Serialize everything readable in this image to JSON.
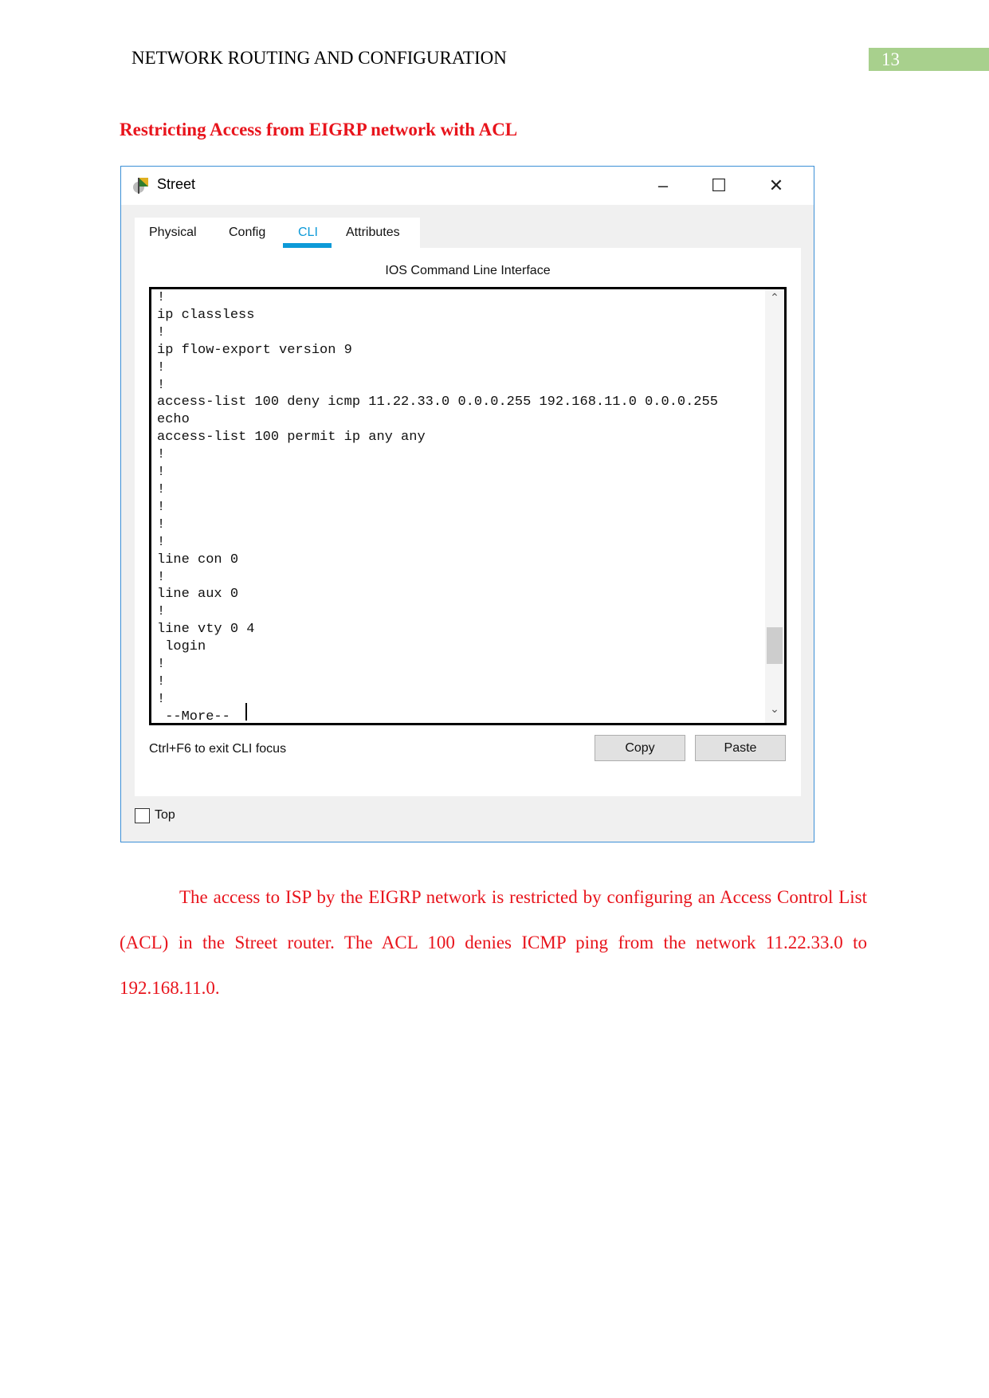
{
  "header": {
    "title": "NETWORK ROUTING AND CONFIGURATION",
    "page_number": "13"
  },
  "heading": "Restricting Access from EIGRP network with ACL",
  "window": {
    "title": "Street",
    "controls": {
      "minimize": "–",
      "maximize": "☐",
      "close": "✕"
    },
    "tabs": [
      {
        "label": "Physical"
      },
      {
        "label": "Config"
      },
      {
        "label": "CLI",
        "active": true
      },
      {
        "label": "Attributes"
      }
    ],
    "cli_title": "IOS Command Line Interface",
    "terminal_lines": [
      "!",
      "ip classless",
      "!",
      "ip flow-export version 9",
      "!",
      "!",
      "access-list 100 deny icmp 11.22.33.0 0.0.0.255 192.168.11.0 0.0.0.255",
      "echo",
      "access-list 100 permit ip any any",
      "!",
      "!",
      "!",
      "!",
      "!",
      "!",
      "line con 0",
      "!",
      "line aux 0",
      "!",
      "line vty 0 4",
      " login",
      "!",
      "!",
      "!",
      " --More-- "
    ],
    "hint": "Ctrl+F6 to exit CLI focus",
    "copy_label": "Copy",
    "paste_label": "Paste",
    "top_label": "Top",
    "top_checked": false
  },
  "paragraph": "The access to ISP by the EIGRP network is restricted by configuring an Access Control List (ACL) in the Street router. The ACL 100 denies ICMP ping from the network 11.22.33.0 to 192.168.11.0.",
  "colors": {
    "accent_red": "#e8141c",
    "page_number_bg": "#a8d08d",
    "tab_active": "#0d9ad8",
    "window_border": "#3c8fd6"
  }
}
